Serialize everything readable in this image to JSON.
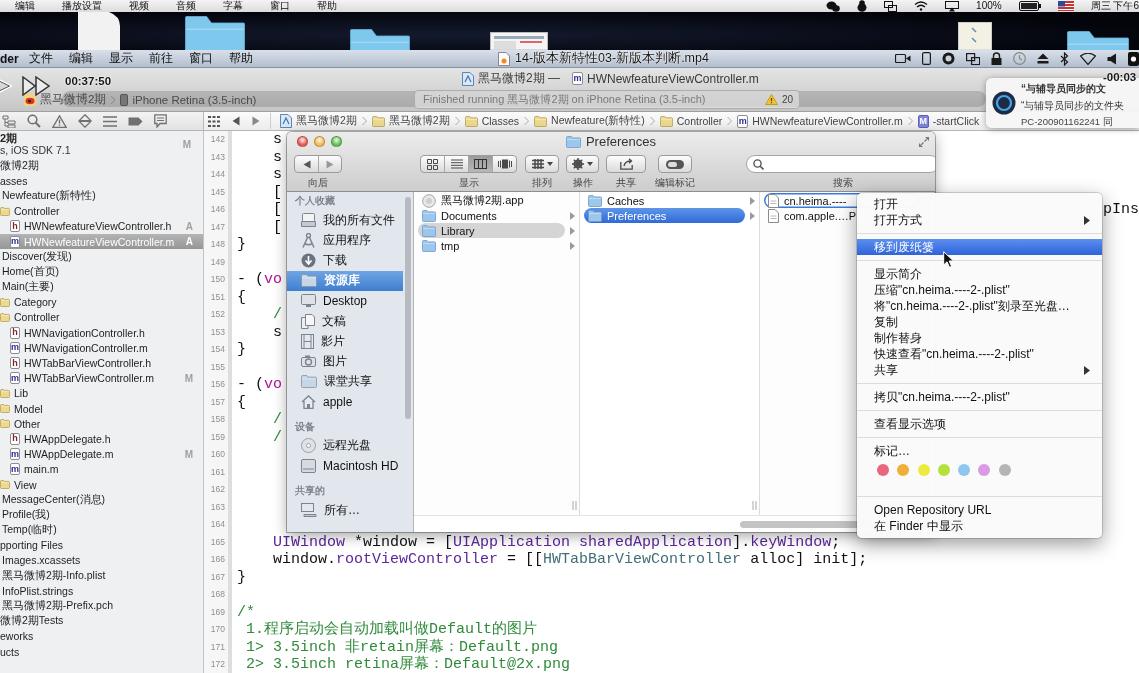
{
  "system_menu_bar": {
    "menus": [
      "编辑",
      "播放设置",
      "视频",
      "音频",
      "字幕",
      "窗口",
      "帮助"
    ],
    "battery": "100%",
    "clock": "周三 下午6"
  },
  "finder_menu_bar": {
    "app": "der",
    "menus": [
      "文件",
      "编辑",
      "显示",
      "前往",
      "窗口",
      "帮助"
    ],
    "video_title": "14-版本新特性03-新版本判断.mp4"
  },
  "video_overlay": {
    "elapsed": "00:37:50",
    "remaining": "-00:03"
  },
  "xcode_toolbar": {
    "scheme": "黑马微博2期",
    "device": "iPhone Retina (3.5-inch)",
    "project_title": "黑马微博2期 —",
    "file_badge": "m",
    "file_title": "HWNewfeatureViewController.m",
    "status": "Finished running 黑马微博2期 on iPhone Retina (3.5-inch)",
    "warnings": "20"
  },
  "notification": {
    "title": "“与辅导员同步的文",
    "body": "“与辅导员同步的文件夹",
    "source": "PC-200901162241 同"
  },
  "jump_bar": [
    {
      "kind": "project",
      "label": "黑马微博2期"
    },
    {
      "kind": "folder",
      "label": "黑马微博2期"
    },
    {
      "kind": "folder",
      "label": "Classes"
    },
    {
      "kind": "folder",
      "label": "Newfeature(新特性)"
    },
    {
      "kind": "folder",
      "label": "Controller"
    },
    {
      "kind": "source",
      "badge": "m",
      "label": "HWNewfeatureViewController.m"
    },
    {
      "kind": "method",
      "badge": "M",
      "label": "-startClick"
    }
  ],
  "navigator": [
    {
      "kind": "project",
      "name": "2期",
      "subtitle": "s, iOS SDK 7.1",
      "status": "M",
      "selected": false,
      "children": [
        {
          "name": "微博2期",
          "selected": false,
          "children": [
            {
              "name": "asses",
              "selected": false,
              "children": [
                {
                  "name": "Newfeature(新特性)",
                  "selected": false,
                  "children": [
                    {
                      "kind": "group",
                      "name": "Controller",
                      "selected": false,
                      "children": [
                        {
                          "kind": "header",
                          "badge": "h",
                          "name": "HWNewfeatureViewController.h",
                          "status": "A",
                          "selected": false
                        },
                        {
                          "kind": "source",
                          "badge": "m",
                          "name": "HWNewfeatureViewController.m",
                          "status": "A",
                          "selected": true
                        }
                      ]
                    }
                  ]
                },
                {
                  "name": "Discover(发现)",
                  "selected": false
                },
                {
                  "name": "Home(首页)",
                  "selected": false
                },
                {
                  "name": "Main(主要)",
                  "selected": false,
                  "children": [
                    {
                      "kind": "group",
                      "name": "Category",
                      "selected": false
                    },
                    {
                      "kind": "group",
                      "name": "Controller",
                      "selected": false,
                      "children": [
                        {
                          "kind": "header",
                          "badge": "h",
                          "name": "HWNavigationController.h",
                          "selected": false
                        },
                        {
                          "kind": "source",
                          "badge": "m",
                          "name": "HWNavigationController.m",
                          "selected": false
                        },
                        {
                          "kind": "header",
                          "badge": "h",
                          "name": "HWTabBarViewController.h",
                          "selected": false
                        },
                        {
                          "kind": "source",
                          "badge": "m",
                          "name": "HWTabBarViewController.m",
                          "status": "M",
                          "selected": false
                        }
                      ]
                    },
                    {
                      "kind": "group",
                      "name": "Lib",
                      "selected": false
                    },
                    {
                      "kind": "group",
                      "name": "Model",
                      "selected": false
                    },
                    {
                      "kind": "group",
                      "name": "Other",
                      "selected": false,
                      "children": [
                        {
                          "kind": "header",
                          "badge": "h",
                          "name": "HWAppDelegate.h",
                          "selected": false
                        },
                        {
                          "kind": "source",
                          "badge": "m",
                          "name": "HWAppDelegate.m",
                          "status": "M",
                          "selected": false
                        },
                        {
                          "kind": "source",
                          "badge": "m",
                          "name": "main.m",
                          "selected": false
                        }
                      ]
                    },
                    {
                      "kind": "group",
                      "name": "View",
                      "selected": false
                    }
                  ]
                },
                {
                  "name": "MessageCenter(消息)",
                  "selected": false
                },
                {
                  "name": "Profile(我)",
                  "selected": false
                },
                {
                  "name": "Temp(临时)",
                  "selected": false
                }
              ]
            },
            {
              "name": "pporting Files",
              "selected": false,
              "children": [
                {
                  "name": "Images.xcassets",
                  "selected": false
                },
                {
                  "name": "黑马微博2期-Info.plist",
                  "selected": false
                },
                {
                  "name": "InfoPlist.strings",
                  "selected": false
                },
                {
                  "name": "黑马微博2期-Prefix.pch",
                  "selected": false
                }
              ]
            }
          ]
        },
        {
          "name": "微博2期Tests",
          "selected": false
        },
        {
          "name": "eworks",
          "selected": false
        },
        {
          "name": "ucts",
          "selected": false
        }
      ]
    }
  ],
  "editor": {
    "lines": [
      {
        "number": "142",
        "segments": [
          {
            "kind": "plain",
            "text": "    s"
          }
        ]
      },
      {
        "number": "143",
        "segments": [
          {
            "kind": "plain",
            "text": "    s"
          }
        ]
      },
      {
        "number": "144",
        "segments": [
          {
            "kind": "plain",
            "text": "    s"
          }
        ]
      },
      {
        "number": "145",
        "segments": [
          {
            "kind": "plain",
            "text": "    ["
          }
        ]
      },
      {
        "number": "146",
        "segments": [
          {
            "kind": "plain",
            "text": "    ["
          }
        ],
        "trailing": "pIns"
      },
      {
        "number": "147",
        "segments": [
          {
            "kind": "plain",
            "text": "    ["
          }
        ]
      },
      {
        "number": "148",
        "segments": [
          {
            "kind": "plain",
            "text": "}"
          }
        ]
      },
      {
        "number": "149"
      },
      {
        "number": "150",
        "segments": [
          {
            "kind": "plain",
            "text": "- ("
          },
          {
            "kind": "keyword",
            "text": "vo"
          }
        ]
      },
      {
        "number": "151",
        "segments": [
          {
            "kind": "plain",
            "text": "{"
          }
        ]
      },
      {
        "number": "152",
        "segments": [
          {
            "kind": "comment",
            "text": "    /"
          }
        ]
      },
      {
        "number": "153",
        "segments": [
          {
            "kind": "plain",
            "text": "    s"
          }
        ]
      },
      {
        "number": "154",
        "segments": [
          {
            "kind": "plain",
            "text": "}"
          }
        ]
      },
      {
        "number": "155"
      },
      {
        "number": "156",
        "segments": [
          {
            "kind": "plain",
            "text": "- ("
          },
          {
            "kind": "keyword",
            "text": "vo"
          }
        ]
      },
      {
        "number": "157",
        "segments": [
          {
            "kind": "plain",
            "text": "{"
          }
        ]
      },
      {
        "number": "158",
        "segments": [
          {
            "kind": "comment",
            "text": "    /"
          }
        ]
      },
      {
        "number": "159",
        "segments": [
          {
            "kind": "comment",
            "text": "    /"
          }
        ]
      },
      {
        "number": "160"
      },
      {
        "number": "161"
      },
      {
        "number": "162"
      },
      {
        "number": "163"
      },
      {
        "number": "164"
      },
      {
        "number": "165",
        "segments": [
          {
            "kind": "class",
            "text": "    UIWindow"
          },
          {
            "kind": "plain",
            "text": " *window = ["
          },
          {
            "kind": "class",
            "text": "UIApplication"
          },
          {
            "kind": "method",
            "text": " sharedApplication"
          },
          {
            "kind": "plain",
            "text": "]."
          },
          {
            "kind": "method",
            "text": "keyWindow"
          },
          {
            "kind": "plain",
            "text": ";"
          }
        ]
      },
      {
        "number": "166",
        "segments": [
          {
            "kind": "plain",
            "text": "    window."
          },
          {
            "kind": "method",
            "text": "rootViewController"
          },
          {
            "kind": "plain",
            "text": " = [["
          },
          {
            "kind": "project_class",
            "text": "HWTabBarViewController"
          },
          {
            "kind": "plain",
            "text": " alloc] init];"
          }
        ]
      },
      {
        "number": "167",
        "segments": [
          {
            "kind": "plain",
            "text": "}"
          }
        ]
      },
      {
        "number": "168"
      },
      {
        "number": "169",
        "segments": [
          {
            "kind": "comment",
            "text": "/*"
          }
        ]
      },
      {
        "number": "170",
        "segments": [
          {
            "kind": "comment",
            "text": " 1.程序启动会自动加载叫做Default的图片"
          }
        ]
      },
      {
        "number": "171",
        "segments": [
          {
            "kind": "comment",
            "text": " 1> 3.5inch 非retain屏幕：Default.png"
          }
        ]
      },
      {
        "number": "172",
        "segments": [
          {
            "kind": "comment",
            "text": " 2> 3.5inch retina屏幕：Default@2x.png"
          }
        ]
      }
    ]
  },
  "finder": {
    "title": "Preferences",
    "toolbar": [
      {
        "kind": "nav",
        "label": "向后"
      },
      {
        "kind": "view",
        "label": "显示",
        "segments": [
          {
            "kind": "icons",
            "selected": false
          },
          {
            "kind": "list",
            "selected": false
          },
          {
            "kind": "columns",
            "selected": true
          },
          {
            "kind": "flow",
            "selected": false
          }
        ]
      },
      {
        "kind": "arrange",
        "label": "排列"
      },
      {
        "kind": "action",
        "label": "操作"
      },
      {
        "kind": "share",
        "label": "共享"
      },
      {
        "kind": "tags",
        "label": "编辑标记"
      }
    ],
    "search_label": "搜索",
    "sidebar": [
      {
        "heading": "个人收藏",
        "items": [
          {
            "kind": "all_files",
            "label": "我的所有文件",
            "selected": false
          },
          {
            "kind": "applications",
            "label": "应用程序",
            "selected": false
          },
          {
            "kind": "downloads",
            "label": "下载",
            "selected": false
          },
          {
            "kind": "folder",
            "label": "资源库",
            "selected": true
          },
          {
            "kind": "desktop",
            "label": "Desktop",
            "selected": false
          },
          {
            "kind": "documents",
            "label": "文稿",
            "selected": false
          },
          {
            "kind": "movies",
            "label": "影片",
            "selected": false
          },
          {
            "kind": "pictures",
            "label": "图片",
            "selected": false
          },
          {
            "kind": "folder",
            "label": "课堂共享",
            "selected": false
          },
          {
            "kind": "home",
            "label": "apple",
            "selected": false
          }
        ]
      },
      {
        "heading": "设备",
        "items": [
          {
            "kind": "disc",
            "label": "远程光盘",
            "selected": false
          },
          {
            "kind": "disk",
            "label": "Macintosh HD",
            "selected": false
          }
        ]
      },
      {
        "heading": "共享的",
        "items": [
          {
            "kind": "network",
            "label": "所有…",
            "selected": false
          }
        ]
      }
    ],
    "columns": [
      {
        "active": false,
        "items": [
          {
            "kind": "app",
            "name": "黑马微博2期.app",
            "selected": false,
            "context_target": false,
            "has_children": false
          },
          {
            "kind": "folder",
            "name": "Documents",
            "selected": false,
            "context_target": false,
            "has_children": true
          },
          {
            "kind": "folder",
            "name": "Library",
            "selected": true,
            "context_target": false,
            "has_children": true
          },
          {
            "kind": "folder",
            "name": "tmp",
            "selected": false,
            "context_target": false,
            "has_children": true
          }
        ]
      },
      {
        "active": true,
        "items": [
          {
            "kind": "folder",
            "name": "Caches",
            "selected": false,
            "context_target": false,
            "has_children": true
          },
          {
            "kind": "folder",
            "name": "Preferences",
            "selected": true,
            "context_target": false,
            "has_children": true
          }
        ]
      },
      {
        "active": false,
        "items": [
          {
            "kind": "plist",
            "name": "cn.heima.----",
            "selected": false,
            "context_target": true,
            "has_children": false
          },
          {
            "kind": "plist",
            "name": "com.apple.…P",
            "selected": false,
            "context_target": false,
            "has_children": false
          }
        ]
      }
    ]
  },
  "context_menu": {
    "items": [
      {
        "kind": "item",
        "label": "打开",
        "selected": false,
        "submenu": false
      },
      {
        "kind": "item",
        "label": "打开方式",
        "selected": false,
        "submenu": true
      },
      {
        "kind": "separator"
      },
      {
        "kind": "item",
        "label": "移到废纸篓",
        "selected": true,
        "submenu": false
      },
      {
        "kind": "separator"
      },
      {
        "kind": "item",
        "label": "显示简介",
        "selected": false,
        "submenu": false
      },
      {
        "kind": "item",
        "label": "压缩\"cn.heima.----2-.plist\"",
        "selected": false,
        "submenu": false
      },
      {
        "kind": "item",
        "label": "将\"cn.heima.----2-.plist\"刻录至光盘…",
        "selected": false,
        "submenu": false
      },
      {
        "kind": "item",
        "label": "复制",
        "selected": false,
        "submenu": false
      },
      {
        "kind": "item",
        "label": "制作替身",
        "selected": false,
        "submenu": false
      },
      {
        "kind": "item",
        "label": "快速查看\"cn.heima.----2-.plist\"",
        "selected": false,
        "submenu": false
      },
      {
        "kind": "item",
        "label": "共享",
        "selected": false,
        "submenu": true
      },
      {
        "kind": "separator"
      },
      {
        "kind": "item",
        "label": "拷贝\"cn.heima.----2-.plist\"",
        "selected": false,
        "submenu": false
      },
      {
        "kind": "separator"
      },
      {
        "kind": "item",
        "label": "查看显示选项",
        "selected": false,
        "submenu": false
      },
      {
        "kind": "separator"
      },
      {
        "kind": "item",
        "label": "标记…",
        "selected": false,
        "submenu": false
      },
      {
        "kind": "tags",
        "tags": [
          {
            "color": "#e9677c"
          },
          {
            "color": "#efb03a"
          },
          {
            "color": "#ecea3c"
          },
          {
            "color": "#b2e23a"
          },
          {
            "color": "#8dc6ee"
          },
          {
            "color": "#dc9ae6"
          },
          {
            "color": "#b5b5b5"
          }
        ]
      },
      {
        "kind": "separator"
      },
      {
        "kind": "item",
        "label": "Open Repository URL",
        "selected": false,
        "submenu": false
      },
      {
        "kind": "item",
        "label": "在 Finder 中显示",
        "selected": false,
        "submenu": false
      }
    ]
  }
}
